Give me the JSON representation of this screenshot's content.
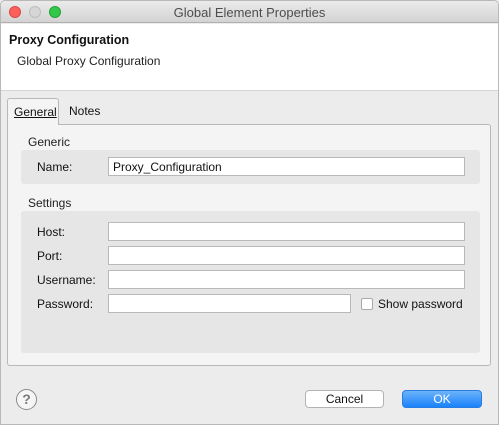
{
  "window": {
    "title": "Global Element Properties"
  },
  "header": {
    "title": "Proxy Configuration",
    "subtitle": "Global Proxy Configuration"
  },
  "tabs": [
    {
      "label": "General",
      "active": true
    },
    {
      "label": "Notes",
      "active": false
    }
  ],
  "generic": {
    "section_label": "Generic",
    "name_label": "Name:",
    "name_value": "Proxy_Configuration"
  },
  "settings": {
    "section_label": "Settings",
    "host_label": "Host:",
    "host_value": "",
    "port_label": "Port:",
    "port_value": "",
    "username_label": "Username:",
    "username_value": "",
    "password_label": "Password:",
    "password_value": "",
    "show_password_label": "Show password",
    "show_password_checked": false
  },
  "footer": {
    "help_symbol": "?",
    "cancel_label": "Cancel",
    "ok_label": "OK"
  },
  "colors": {
    "ok_button": "#1a82fb",
    "close_light": "#fc605c",
    "maximize_light": "#34c84a"
  }
}
